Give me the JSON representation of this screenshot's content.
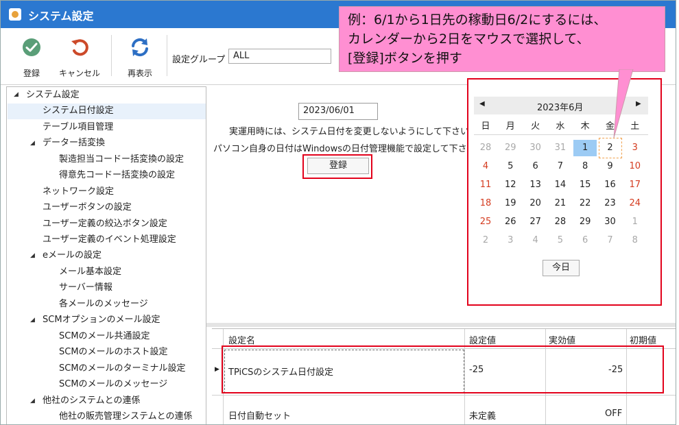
{
  "window": {
    "title": "システム設定"
  },
  "toolbar": {
    "register_label": "登録",
    "cancel_label": "キャンセル",
    "refresh_label": "再表示",
    "setting_group_label": "設定グループ",
    "setting_group_value": "ALL"
  },
  "tree": {
    "root": "システム設定",
    "items": [
      "システム日付設定",
      "テーブル項目管理",
      "データー括変換",
      "製造担当コードー括変換の設定",
      "得意先コードー括変換の設定",
      "ネットワーク設定",
      "ユーザーボタンの設定",
      "ユーザー定義の絞込ボタン設定",
      "ユーザー定義のイベント処理設定",
      "eメールの設定",
      "メール基本設定",
      "サーバー情報",
      "各メールのメッセージ",
      "SCMオプションのメール設定",
      "SCMのメール共通設定",
      "SCMのメールのホスト設定",
      "SCMのメールのターミナル設定",
      "SCMのメールのメッセージ",
      "他社のシステムとの連係",
      "他社の販売管理システムとの連係"
    ]
  },
  "form": {
    "date_value": "2023/06/01",
    "info_line1": "実運用時には、システム日付を変更しないようにして下さい",
    "info_line2": "パソコン自身の日付はWindowsの日付管理機能で設定して下さい",
    "register_button": "登録"
  },
  "calendar": {
    "prev": "◀",
    "next": "▶",
    "month_label": "2023年6月",
    "weekdays": [
      "日",
      "月",
      "火",
      "水",
      "木",
      "金",
      "土"
    ],
    "weeks": [
      [
        "28",
        "29",
        "30",
        "31",
        "1",
        "2",
        "3"
      ],
      [
        "4",
        "5",
        "6",
        "7",
        "8",
        "9",
        "10"
      ],
      [
        "11",
        "12",
        "13",
        "14",
        "15",
        "16",
        "17"
      ],
      [
        "18",
        "19",
        "20",
        "21",
        "22",
        "23",
        "24"
      ],
      [
        "25",
        "26",
        "27",
        "28",
        "29",
        "30",
        "1"
      ],
      [
        "2",
        "3",
        "4",
        "5",
        "6",
        "7",
        "8"
      ]
    ],
    "today_button": "今日",
    "colors": {
      "sunday": "#d43b1f",
      "saturday": "#d43b1f",
      "other_month": "#a8a8a8",
      "selected_bg": "#9ccbf4",
      "focus_border": "#f0a04b"
    }
  },
  "callout": {
    "line1": "例：6/1から1日先の稼動日6/2にするには、",
    "line2": "カレンダーから2日をマウスで選択して、",
    "line3": "[登録]ボタンを押す"
  },
  "grid": {
    "headers": [
      "設定名",
      "設定値",
      "実効値",
      "初期値"
    ],
    "rows": [
      {
        "name": "TPiCSのシステム日付設定",
        "value": "-25",
        "effective": "-25",
        "initial": ""
      },
      {
        "name": "日付自動セット",
        "value": "未定義",
        "effective": "OFF",
        "initial": ""
      }
    ]
  }
}
